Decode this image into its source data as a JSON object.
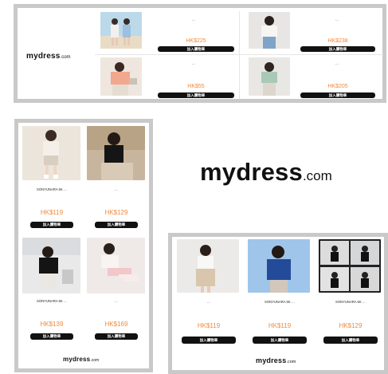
{
  "brand": {
    "logo_main": "mydress",
    "logo_tld": ".com"
  },
  "banner_top": {
    "products": [
      {
        "title": "…",
        "price": "HK$225",
        "button": "加入購物車"
      },
      {
        "title": "…",
        "price": "HK$238",
        "button": "加入購物車"
      },
      {
        "title": "…",
        "price": "HK$55",
        "button": "加入購物車"
      },
      {
        "title": "…",
        "price": "HK$205",
        "button": "加入購物車"
      }
    ]
  },
  "banner_left": {
    "products": [
      {
        "title": "SONYUNARA 5K …",
        "price": "HK$119",
        "button": "加入購物車"
      },
      {
        "title": "…",
        "price": "HK$129",
        "button": "加入購物車"
      },
      {
        "title": "SONYUNARA 5K …",
        "price": "HK$139",
        "button": "加入購物車"
      },
      {
        "title": "…",
        "price": "HK$169",
        "button": "加入購物車"
      }
    ]
  },
  "banner_bottom": {
    "products": [
      {
        "title": "…",
        "price": "HK$119",
        "button": "加入購物車"
      },
      {
        "title": "SONYUNARA 5K …",
        "price": "HK$119",
        "button": "加入購物車"
      },
      {
        "title": "SONYUNARA 5K …",
        "price": "HK$129",
        "button": "加入購物車"
      }
    ]
  },
  "colors": {
    "price": "#f08a3c",
    "button": "#111111",
    "frame": "#c9c9c9"
  }
}
